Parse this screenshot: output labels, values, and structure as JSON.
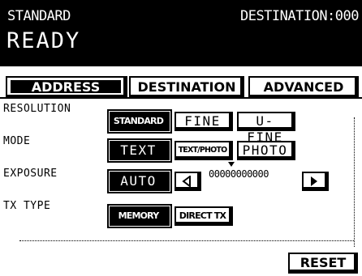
{
  "header": {
    "mode": "STANDARD",
    "destination": "DESTINATION:000",
    "status": "READY"
  },
  "tabs": [
    {
      "label": "ADDRESS"
    },
    {
      "label": "DESTINATION"
    },
    {
      "label": "ADVANCED"
    }
  ],
  "settings": {
    "resolution": {
      "label": "RESOLUTION",
      "options": [
        "STANDARD",
        "FINE",
        "U-FINE"
      ],
      "selected": "STANDARD"
    },
    "mode": {
      "label": "MODE",
      "options": [
        "TEXT",
        "TEXT/PHOTO",
        "PHOTO"
      ],
      "selected": "TEXT"
    },
    "exposure": {
      "label": "EXPOSURE",
      "auto": "AUTO",
      "scale": "00000000000",
      "left_icon": "triangle-left-icon",
      "right_icon": "triangle-right-icon"
    },
    "tx_type": {
      "label": "TX TYPE",
      "options": [
        "MEMORY TX",
        "DIRECT TX"
      ],
      "selected": "MEMORY TX"
    }
  },
  "actions": {
    "reset": "RESET"
  }
}
